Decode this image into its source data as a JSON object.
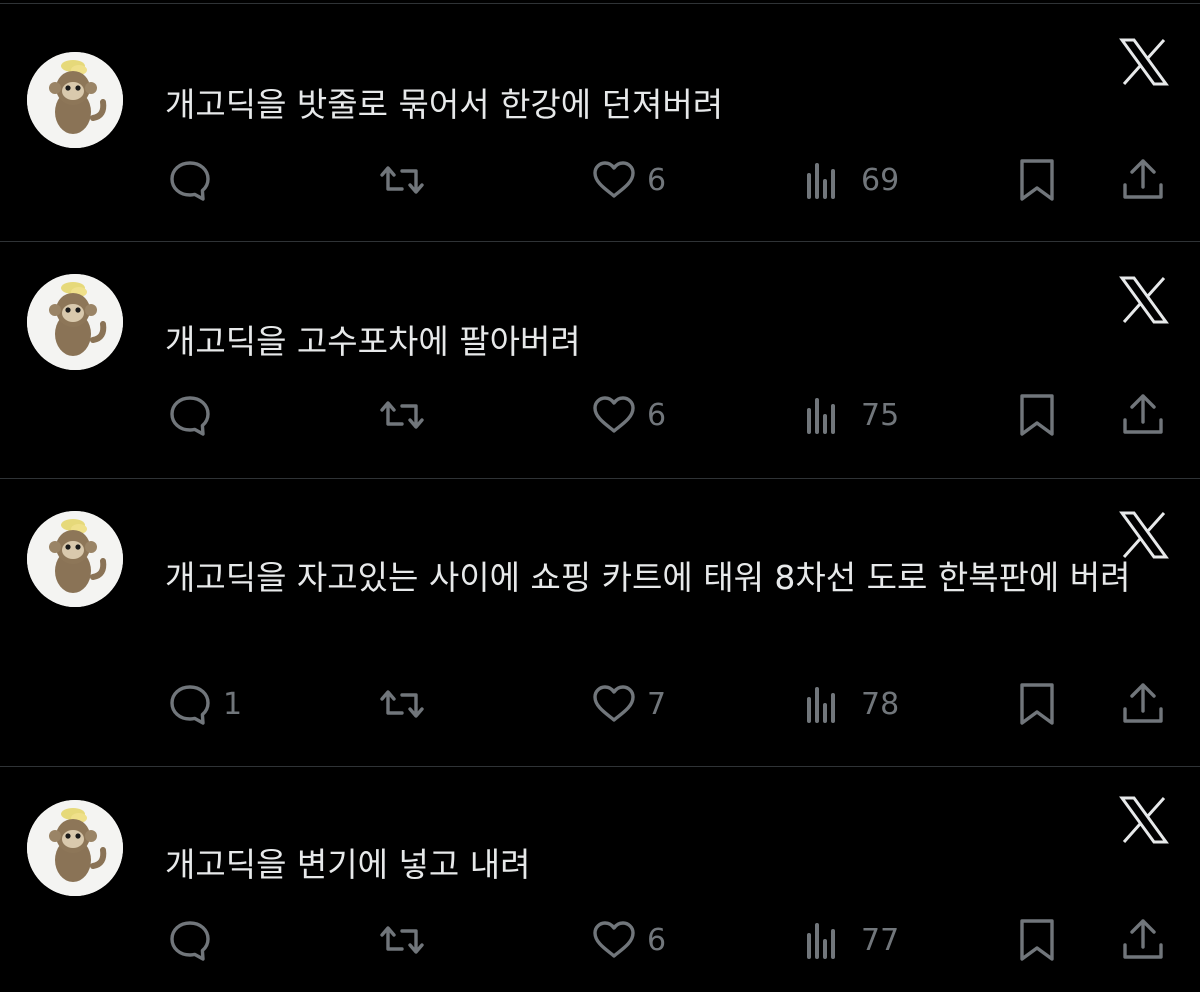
{
  "posts": [
    {
      "text": "개고딕을 밧줄로 묶어서 한강에 던져버려",
      "replies": "",
      "likes": "6",
      "views": "69"
    },
    {
      "text": "개고딕을 고수포차에 팔아버려",
      "replies": "",
      "likes": "6",
      "views": "75"
    },
    {
      "text": "개고딕을 자고있는 사이에 쇼핑 카트에 태워 8차선 도로 한복판에 버려",
      "replies": "1",
      "likes": "7",
      "views": "78"
    },
    {
      "text": "개고딕을 변기에 넣고 내려",
      "replies": "",
      "likes": "6",
      "views": "77"
    }
  ],
  "icons": {
    "reply": "speech-bubble-icon",
    "repost": "repost-arrows-icon",
    "like": "heart-icon",
    "views": "bar-chart-icon",
    "bookmark": "bookmark-icon",
    "share": "share-upload-icon",
    "platform": "x-logo-icon"
  },
  "colors": {
    "background": "#000000",
    "text": "#e7e9ea",
    "icon": "#71767b",
    "divider": "#2f3336"
  }
}
